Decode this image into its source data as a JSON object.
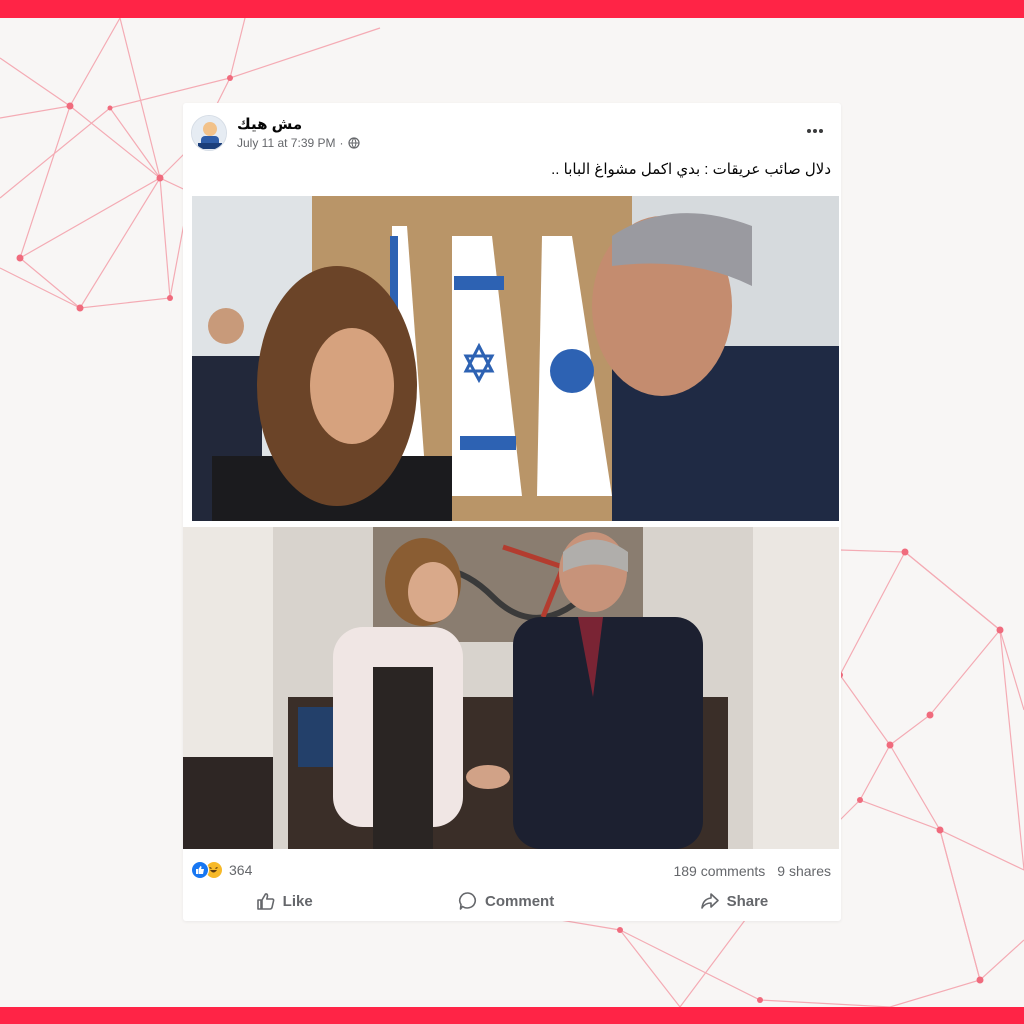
{
  "colors": {
    "accent": "#ff2446",
    "facebook_blue": "#1877f2",
    "muted_text": "#65676b"
  },
  "post": {
    "page_name": "مش هيك",
    "timestamp": "July 11 at 7:39 PM",
    "separator": "·",
    "privacy_icon": "globe-icon",
    "caption": "دلال صائب عريقات : بدي اكمل مشواغ البابا ..",
    "reactions": {
      "icons": [
        "like-icon",
        "haha-icon"
      ],
      "count": "364"
    },
    "comments": "189 comments",
    "shares": "9 shares",
    "actions": {
      "like": "Like",
      "comment": "Comment",
      "share": "Share"
    }
  }
}
